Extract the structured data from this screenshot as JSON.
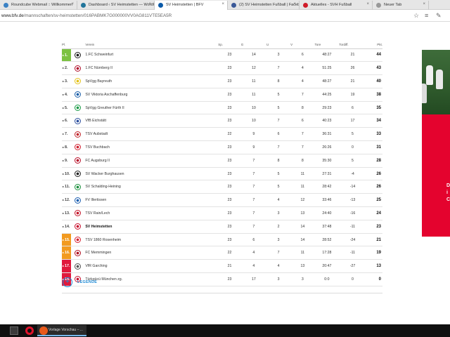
{
  "browser": {
    "tabs": [
      {
        "label": "Roundcube Webmail :: Willkommen",
        "color": "#3b82c4"
      },
      {
        "label": "Dashboard ‹ SV Heimstetten — WordPress",
        "color": "#21759b"
      },
      {
        "label": "SV Heimstetten | BFV",
        "color": "#0a5aa8"
      },
      {
        "label": "(2) SV Heimstetten Fußball | Facebook",
        "color": "#3b5998"
      },
      {
        "label": "Aktuelles - SVH Fußball",
        "color": "#d01c2a"
      },
      {
        "label": "Neuer Tab",
        "color": "#999999"
      }
    ],
    "active_tab": 2,
    "url_host": "www.bfv.de",
    "url_path": "/mannschaften/sv-heimstetten/016PABMK7G000000VV0AG811VTE5EA5R"
  },
  "table": {
    "headers": {
      "pos": "Pl.",
      "team": "Verein",
      "games": "Sp.",
      "won": "G",
      "draw": "U",
      "lost": "V",
      "goals": "Tore",
      "diff": "Tordiff.",
      "points": "Pkt."
    },
    "rows": [
      {
        "pos": "1.",
        "trend": "▸",
        "status": "up",
        "team": "1.FC Schweinfurt",
        "games": "23",
        "won": "14",
        "draw": "3",
        "lost": "6",
        "goals": "48:27",
        "diff": "21",
        "points": "44",
        "logo_color": "#1a1a1a",
        "bold": false
      },
      {
        "pos": "2.",
        "trend": "▸",
        "status": "",
        "team": "1.FC Nürnberg II",
        "games": "23",
        "won": "12",
        "draw": "7",
        "lost": "4",
        "goals": "51:25",
        "diff": "26",
        "points": "43",
        "logo_color": "#b0102b",
        "bold": false
      },
      {
        "pos": "3.",
        "trend": "▸",
        "status": "",
        "team": "SpVgg Bayreuth",
        "games": "23",
        "won": "11",
        "draw": "8",
        "lost": "4",
        "goals": "48:27",
        "diff": "21",
        "points": "40",
        "logo_color": "#e4c21a",
        "bold": false
      },
      {
        "pos": "4.",
        "trend": "▸",
        "status": "",
        "team": "SV Viktoria Aschaffenburg",
        "games": "23",
        "won": "11",
        "draw": "5",
        "lost": "7",
        "goals": "44:25",
        "diff": "19",
        "points": "38",
        "logo_color": "#1c5fa8",
        "bold": false
      },
      {
        "pos": "5.",
        "trend": "▸",
        "status": "",
        "team": "SpVgg Greuther Fürth II",
        "games": "23",
        "won": "10",
        "draw": "5",
        "lost": "8",
        "goals": "29:23",
        "diff": "6",
        "points": "35",
        "logo_color": "#1a9a46",
        "bold": false
      },
      {
        "pos": "6.",
        "trend": "▸",
        "status": "",
        "team": "VfB Eichstätt",
        "games": "23",
        "won": "10",
        "draw": "7",
        "lost": "6",
        "goals": "40:23",
        "diff": "17",
        "points": "34",
        "logo_color": "#2c4f9e",
        "bold": false
      },
      {
        "pos": "7.",
        "trend": "▸",
        "status": "",
        "team": "TSV Aubstadt",
        "games": "22",
        "won": "9",
        "draw": "6",
        "lost": "7",
        "goals": "36:31",
        "diff": "5",
        "points": "33",
        "logo_color": "#c1272d",
        "bold": false
      },
      {
        "pos": "8.",
        "trend": "▸",
        "status": "",
        "team": "TSV Buchbach",
        "games": "23",
        "won": "9",
        "draw": "7",
        "lost": "7",
        "goals": "26:26",
        "diff": "0",
        "points": "31",
        "logo_color": "#d02030",
        "bold": false
      },
      {
        "pos": "9.",
        "trend": "▸",
        "status": "",
        "team": "FC Augsburg II",
        "games": "23",
        "won": "7",
        "draw": "8",
        "lost": "8",
        "goals": "35:30",
        "diff": "5",
        "points": "28",
        "logo_color": "#b8102a",
        "bold": false
      },
      {
        "pos": "10.",
        "trend": "▸",
        "status": "",
        "team": "SV Wacker Burghausen",
        "games": "23",
        "won": "7",
        "draw": "5",
        "lost": "11",
        "goals": "27:31",
        "diff": "-4",
        "points": "26",
        "logo_color": "#222222",
        "bold": false
      },
      {
        "pos": "11.",
        "trend": "▸",
        "status": "",
        "team": "SV Schalding-Heining",
        "games": "23",
        "won": "7",
        "draw": "5",
        "lost": "11",
        "goals": "28:42",
        "diff": "-14",
        "points": "26",
        "logo_color": "#1a8f3c",
        "bold": false
      },
      {
        "pos": "12.",
        "trend": "▸",
        "status": "",
        "team": "FV Illertissen",
        "games": "23",
        "won": "7",
        "draw": "4",
        "lost": "12",
        "goals": "33:46",
        "diff": "-13",
        "points": "25",
        "logo_color": "#1d5fb0",
        "bold": false
      },
      {
        "pos": "13.",
        "trend": "▸",
        "status": "",
        "team": "TSV Rain/Lech",
        "games": "23",
        "won": "7",
        "draw": "3",
        "lost": "13",
        "goals": "24:40",
        "diff": "-16",
        "points": "24",
        "logo_color": "#c4162a",
        "bold": false
      },
      {
        "pos": "14.",
        "trend": "▸",
        "status": "",
        "team": "SV Heimstetten",
        "games": "23",
        "won": "7",
        "draw": "2",
        "lost": "14",
        "goals": "37:48",
        "diff": "-11",
        "points": "23",
        "logo_color": "#c8102e",
        "bold": true
      },
      {
        "pos": "15.",
        "trend": "▸",
        "status": "rel",
        "team": "TSV 1860 Rosenheim",
        "games": "23",
        "won": "6",
        "draw": "3",
        "lost": "14",
        "goals": "28:52",
        "diff": "-24",
        "points": "21",
        "logo_color": "#d62030",
        "bold": false
      },
      {
        "pos": "16.",
        "trend": "▸",
        "status": "rel",
        "team": "FC Memmingen",
        "games": "22",
        "won": "4",
        "draw": "7",
        "lost": "11",
        "goals": "17:28",
        "diff": "-11",
        "points": "19",
        "logo_color": "#b01020",
        "bold": false
      },
      {
        "pos": "17.",
        "trend": "▸",
        "status": "down",
        "team": "VfR Garching",
        "games": "21",
        "won": "4",
        "draw": "4",
        "lost": "13",
        "goals": "20:47",
        "diff": "-27",
        "points": "13",
        "logo_color": "#555555",
        "bold": false
      },
      {
        "pos": "18.",
        "trend": "▸",
        "status": "down",
        "team": "Türkgücü München zg.",
        "games": "23",
        "won": "17",
        "draw": "3",
        "lost": "3",
        "goals": "0:0",
        "diff": "0",
        "points": "0",
        "logo_color": "#c8102e",
        "bold": false
      }
    ]
  },
  "legend": {
    "icon": "plus-icon",
    "label": "LEGENDE"
  },
  "ad": {
    "accent": "#e4032e",
    "letters": [
      "D",
      "i",
      "C"
    ]
  },
  "taskbar": {
    "task_label": "Vorlage Vorschau – ..."
  }
}
